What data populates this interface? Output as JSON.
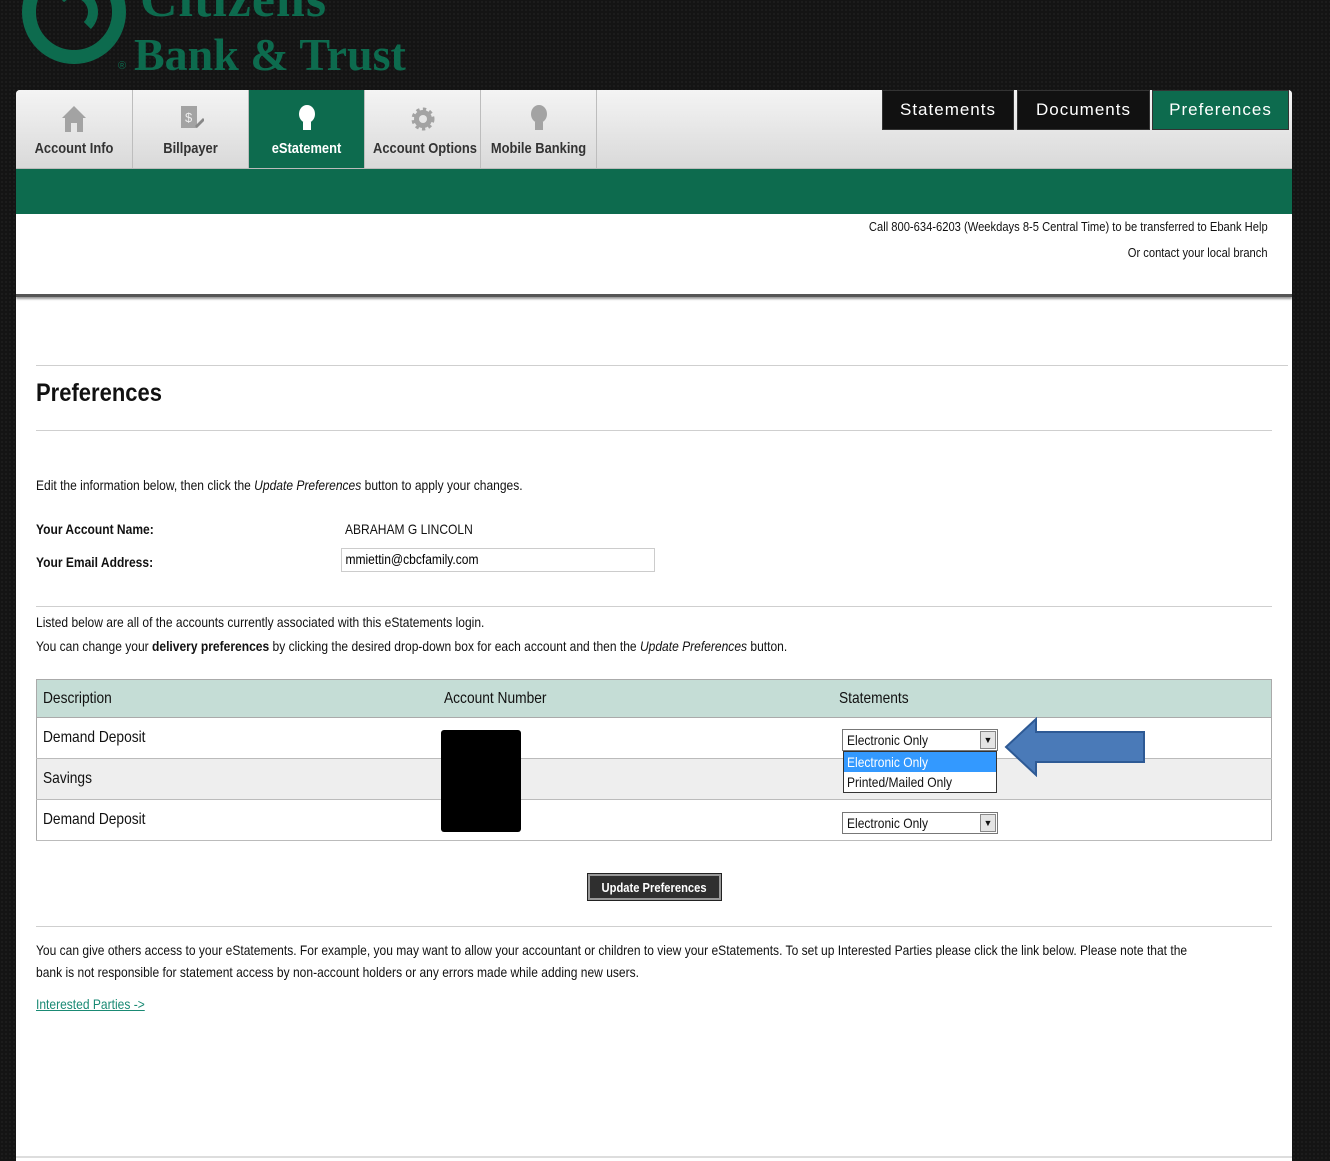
{
  "brand": {
    "top_text": "Citizens",
    "name": "Bank & Trust",
    "reg": "®"
  },
  "nav": {
    "tabs": [
      {
        "label": "Account Info",
        "icon": "home-icon"
      },
      {
        "label": "Billpayer",
        "icon": "bill-icon"
      },
      {
        "label": "eStatement",
        "icon": "lightbulb-icon",
        "active": true
      },
      {
        "label": "Account Options",
        "icon": "gear-icon"
      },
      {
        "label": "Mobile Banking",
        "icon": "lightbulb-icon"
      }
    ]
  },
  "help": {
    "line1": "Call 800-634-6203 (Weekdays 8-5 Central Time) to be transferred to Ebank Help",
    "line2": "Or contact your local branch"
  },
  "subtabs": [
    "Statements",
    "Documents",
    "Preferences"
  ],
  "page_title": "Preferences",
  "intro": {
    "before": "Edit the information below, then click the ",
    "em": "Update Preferences",
    "after": " button to apply your changes."
  },
  "account": {
    "name_label": "Your Account Name:",
    "name_value": "ABRAHAM G LINCOLN",
    "email_label": "Your Email Address:",
    "email_value": "mmiettin@cbcfamily.com"
  },
  "listed": {
    "line1": "Listed below are all of the accounts currently associated with this eStatements login.",
    "line2_a": "You can change your ",
    "line2_b": "delivery preferences",
    "line2_c": " by clicking the desired drop-down box for each account and then the ",
    "line2_d": "Update Preferences",
    "line2_e": " button."
  },
  "table": {
    "headers": [
      "Description",
      "Account Number",
      "Statements"
    ],
    "rows": [
      {
        "description": "Demand Deposit",
        "statement": "Electronic Only"
      },
      {
        "description": "Savings",
        "statement": ""
      },
      {
        "description": "Demand Deposit",
        "statement": "Electronic Only"
      }
    ],
    "dropdown_options": [
      "Electronic Only",
      "Printed/Mailed Only"
    ]
  },
  "update_button": "Update Preferences",
  "info": {
    "line1": "You can give others access to your eStatements. For example, you may want to allow your accountant or children to view your eStatements. To set up Interested Parties please click the link below. Please note that the",
    "line2": "bank is not responsible for statement access by non-account holders or any errors made while adding new users."
  },
  "link": "Interested Parties ->",
  "colors": {
    "brand_green": "#0d6b4e",
    "table_header": "#c5ddd6",
    "arrow": "#4a7ab8"
  }
}
